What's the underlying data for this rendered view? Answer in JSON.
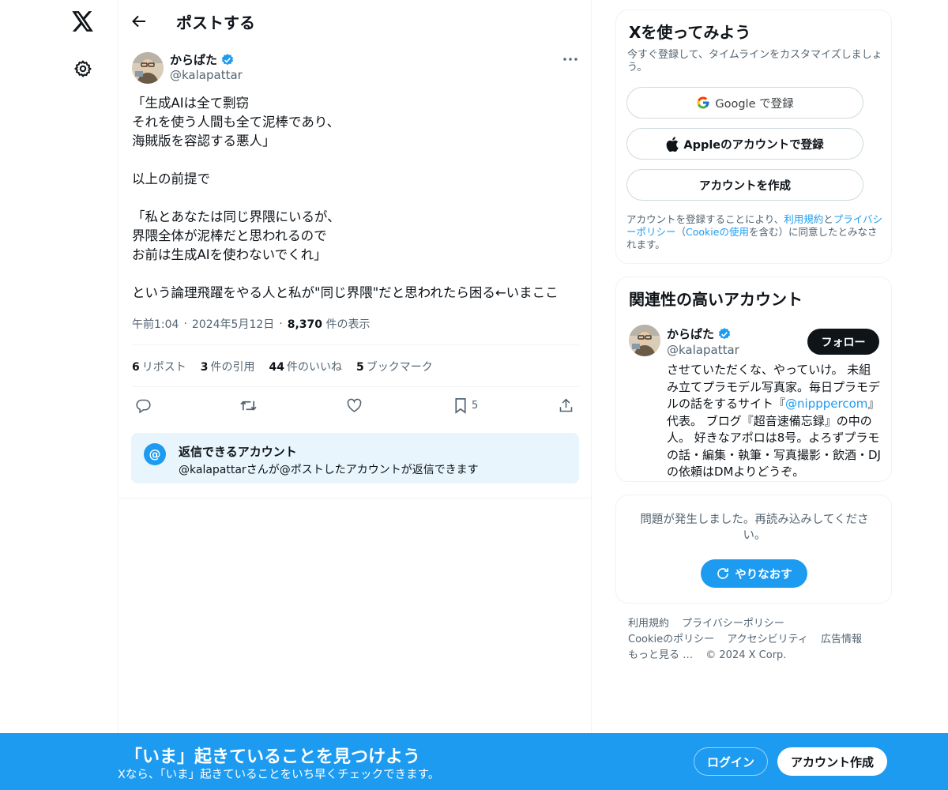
{
  "nav": {
    "logo_icon": "x-logo-icon",
    "settings_icon": "gear-icon"
  },
  "header": {
    "title": "ポストする"
  },
  "post": {
    "author_name": "からぱた",
    "author_handle": "@kalapattar",
    "text": "「生成AIは全て剽窃\nそれを使う人間も全て泥棒であり、\n海賊版を容認する悪人」\n\n以上の前提で\n\n「私とあなたは同じ界隈にいるが、\n界隈全体が泥棒だと思われるので\nお前は生成AIを使わないでくれ」\n\nという論理飛躍をやる人と私が\"同じ界隈\"だと思われたら困る←いまここ",
    "time": "午前1:04",
    "date": "2024年5月12日",
    "sep": "·",
    "views_count": "8,370",
    "views_label": "件の表示",
    "stats": {
      "reposts_count": "6",
      "reposts_label": "リポスト",
      "quotes_count": "3",
      "quotes_label": "件の引用",
      "likes_count": "44",
      "likes_label": "件のいいね",
      "bookmarks_count": "5",
      "bookmarks_label": "ブックマーク"
    },
    "actions": {
      "bookmark_count": "5"
    },
    "reply_restriction": {
      "icon": "@",
      "title": "返信できるアカウント",
      "subtitle": "@kalapattarさんが@ポストしたアカウントが返信できます"
    }
  },
  "signup_card": {
    "title": "Xを使ってみよう",
    "subtitle": "今すぐ登録して、タイムラインをカスタマイズしましょう。",
    "google_label": "Google で登録",
    "apple_label": "Appleのアカウントで登録",
    "create_label": "アカウントを作成",
    "legal_prefix": "アカウントを登録することにより、",
    "terms_link": "利用規約",
    "legal_and": "と",
    "privacy_link": "プライバシーポリシー",
    "legal_paren_open": "（",
    "cookie_link": "Cookieの使用",
    "legal_suffix": "を含む）に同意したとみなされます。"
  },
  "related_card": {
    "title": "関連性の高いアカウント",
    "name": "からぱた",
    "handle": "@kalapattar",
    "follow_label": "フォロー",
    "bio_before": "させていただくな、やっていけ。 未組み立てプラモデル写真家。毎日プラモデルの話をするサイト『",
    "bio_link": "@nipppercom",
    "bio_after": "』代表。 ブログ『超音速備忘録』の中の人。 好きなアポロは8号。よろずプラモの話・編集・執筆・写真撮影・飲酒・DJの依頼はDMよりどうぞ。"
  },
  "error_card": {
    "message": "問題が発生しました。再読み込みしてください。",
    "retry_label": "やりなおす"
  },
  "footer": {
    "links": [
      "利用規約",
      "プライバシーポリシー",
      "Cookieのポリシー",
      "アクセシビリティ",
      "広告情報",
      "もっと見る …"
    ],
    "copyright": "© 2024 X Corp."
  },
  "banner": {
    "title": "「いま」起きていることを見つけよう",
    "subtitle": "Xなら、「いま」起きていることをいち早くチェックできます。",
    "login_label": "ログイン",
    "signup_label": "アカウント作成"
  },
  "colors": {
    "accent": "#1d9bf0",
    "text": "#0f1419",
    "secondary": "#536471",
    "border": "#eff3f4"
  }
}
